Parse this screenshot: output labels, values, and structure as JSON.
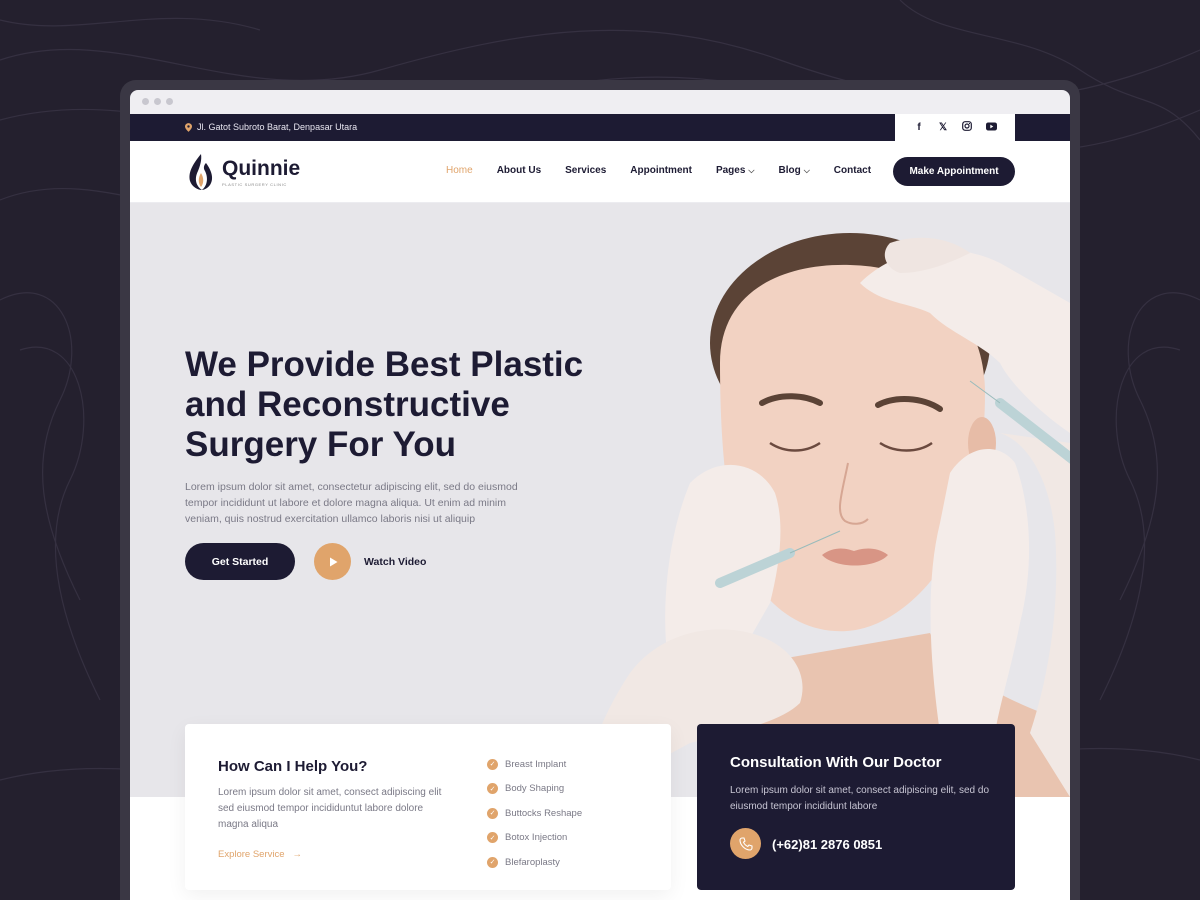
{
  "topbar": {
    "address": "Jl. Gatot Subroto Barat, Denpasar Utara",
    "socials": [
      "facebook-icon",
      "x-icon",
      "instagram-icon",
      "youtube-icon"
    ]
  },
  "brand": {
    "name": "Quinnie",
    "tagline": "PLASTIC SURGERY CLINIC"
  },
  "nav": {
    "items": [
      {
        "label": "Home",
        "active": true
      },
      {
        "label": "About Us"
      },
      {
        "label": "Services"
      },
      {
        "label": "Appointment"
      },
      {
        "label": "Pages",
        "dropdown": true
      },
      {
        "label": "Blog",
        "dropdown": true
      },
      {
        "label": "Contact"
      }
    ],
    "cta": "Make Appointment"
  },
  "hero": {
    "title": "We Provide Best Plastic and Reconstructive Surgery For You",
    "lead": "Lorem ipsum dolor sit amet, consectetur adipiscing elit, sed do eiusmod tempor incididunt ut labore et dolore magna aliqua. Ut enim ad minim veniam, quis nostrud exercitation ullamco laboris nisi ut aliquip",
    "primary_button": "Get Started",
    "video_label": "Watch Video"
  },
  "help_card": {
    "title": "How Can I Help You?",
    "description": "Lorem ipsum dolor sit amet, consect adipiscing elit sed eiusmod tempor incididuntut labore dolore magna aliqua",
    "link": "Explore Service",
    "services": [
      "Breast Implant",
      "Body Shaping",
      "Buttocks Reshape",
      "Botox Injection",
      "Blefaroplasty"
    ]
  },
  "consult_card": {
    "title": "Consultation With Our Doctor",
    "description": "Lorem ipsum dolor sit amet, consect adipiscing elit, sed do eiusmod tempor incididunt labore",
    "phone": "(+62)81 2876 0851"
  },
  "colors": {
    "navy": "#1d1b33",
    "accent": "#e0a46b",
    "hero_bg": "#e7e6ea",
    "outer_bg": "#24202e"
  }
}
